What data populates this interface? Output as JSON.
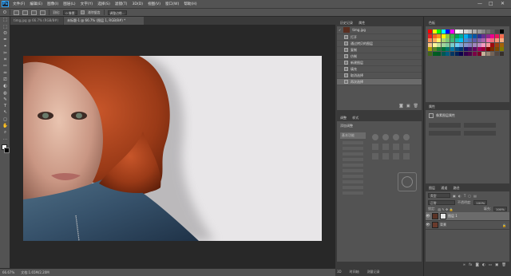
{
  "app": {
    "logo": "Ps",
    "menu": [
      "文件(F)",
      "编辑(E)",
      "图像(I)",
      "图层(L)",
      "文字(Y)",
      "选择(S)",
      "滤镜(T)",
      "3D(D)",
      "视图(V)",
      "窗口(W)",
      "帮助(H)"
    ],
    "window_controls": [
      "—",
      "□",
      "✕"
    ]
  },
  "options_bar": {
    "feather_label": "羽化:",
    "feather_value": "0 像素",
    "antialias_label": "消除锯齿",
    "refine_button": "调整边缘..."
  },
  "tools": [
    "⬚",
    "⬚",
    "ʘ",
    "✒",
    "⌖",
    "✂",
    "⌗",
    "✏",
    "♒",
    "⎚",
    "◐",
    "◍",
    "✎",
    "T",
    "↖",
    "◻",
    "✋",
    "⌕",
    "⋯"
  ],
  "document": {
    "tabs": [
      "timg.jpg @ 66.7% (RGB/8#)",
      "未标题-1 @ 66.7% (图层 1, RGB/8#) *"
    ],
    "active_tab": 1
  },
  "status": {
    "zoom": "66.67%",
    "doc_info": "文档:1.65M/2.20M"
  },
  "history": {
    "tabs": [
      "历史记录",
      "属性"
    ],
    "snapshot": "timg.jpg",
    "items": [
      "打开",
      "通过拷贝的图层",
      "复制",
      "仿制",
      "新建图层",
      "填充",
      "取消选择",
      "再次选择"
    ],
    "selected_index": 7
  },
  "swatches": {
    "tab": "色板",
    "colors": [
      "#ff0000",
      "#ffff00",
      "#00ff00",
      "#00ffff",
      "#0000ff",
      "#ff00ff",
      "#ffffff",
      "#ebebeb",
      "#d6d6d6",
      "#c2c2c2",
      "#adadad",
      "#999999",
      "#858585",
      "#707070",
      "#5c5c5c",
      "#474747",
      "#000000",
      "#ed1c24",
      "#f26522",
      "#f7941d",
      "#fff200",
      "#8dc63f",
      "#39b54a",
      "#00a651",
      "#00a99d",
      "#00aeef",
      "#0072bc",
      "#0054a6",
      "#2e3192",
      "#662d91",
      "#92278f",
      "#ec008c",
      "#ed145b",
      "#f26c4f",
      "#f68e56",
      "#fbaf5d",
      "#fff568",
      "#acd373",
      "#7cc576",
      "#3cb878",
      "#1abbb4",
      "#00bff3",
      "#448ccb",
      "#5674b9",
      "#605ca8",
      "#8560a8",
      "#a864a8",
      "#f06eaa",
      "#f26d7d",
      "#f69679",
      "#f9ad81",
      "#fdc689",
      "#fff799",
      "#c4df9b",
      "#a3d39c",
      "#82ca9c",
      "#7accc8",
      "#6dcff6",
      "#7da7d9",
      "#8393ca",
      "#8781bd",
      "#a186be",
      "#bd8cbf",
      "#f49ac1",
      "#f5989d",
      "#9e0b0f",
      "#a0410d",
      "#a36209",
      "#aba000",
      "#598527",
      "#1a7b30",
      "#007236",
      "#00746b",
      "#0076a3",
      "#004b80",
      "#003471",
      "#1b1464",
      "#440e62",
      "#630460",
      "#9e005d",
      "#9e0039",
      "#790000",
      "#7b2e00",
      "#7d4900",
      "#827b00",
      "#406618",
      "#005e20",
      "#005826",
      "#005952",
      "#005b7f",
      "#003663",
      "#002157",
      "#0d004c",
      "#32004b",
      "#4b0049",
      "#7b0046",
      "#7a0026",
      "#c7b299",
      "#998675",
      "#736357",
      "#534741",
      "#37302a"
    ],
    "accent": "#31a8ff"
  },
  "properties_panel": {
    "tabs": [
      "调整",
      "样式"
    ],
    "title": "添加调整",
    "group_tab": "基本功能"
  },
  "char_panel": {
    "tab": "属性",
    "label": "像素图层属性"
  },
  "layers": {
    "tabs": [
      "图层",
      "通道",
      "路径"
    ],
    "kind_label": "类型",
    "blend_mode": "正常",
    "opacity_label": "不透明度:",
    "opacity_value": "100%",
    "lock_label": "锁定:",
    "fill_label": "填充:",
    "fill_value": "100%",
    "rows": [
      {
        "name": "图层 1",
        "selected": true
      },
      {
        "name": "背景",
        "selected": false
      }
    ]
  },
  "bottom_panels": [
    "3D",
    "时间轴",
    "测量记录"
  ]
}
